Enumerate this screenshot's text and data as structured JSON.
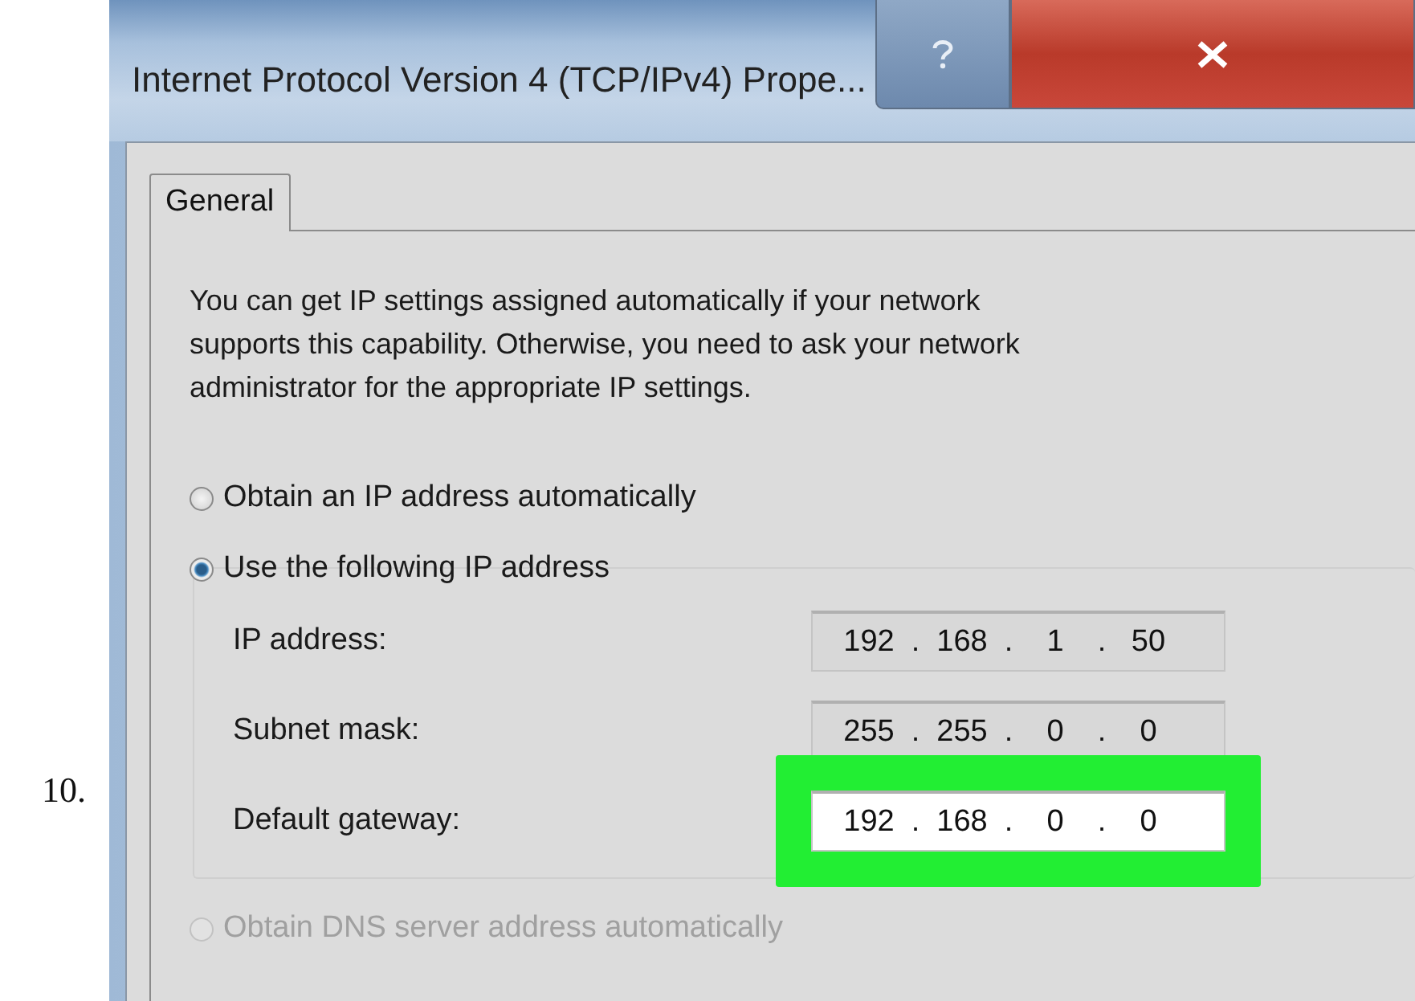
{
  "step_number": "10.",
  "window": {
    "title": "Internet Protocol Version 4 (TCP/IPv4) Prope..."
  },
  "tabs": [
    {
      "label": "General",
      "selected": true
    }
  ],
  "intro": "You can get IP settings assigned automatically if your network supports this capability. Otherwise, you need to ask your network administrator for the appropriate IP settings.",
  "ip_options": [
    {
      "label": "Obtain an IP address automatically",
      "selected": false,
      "disabled": false
    },
    {
      "label": "Use the following IP address",
      "selected": true,
      "disabled": false
    }
  ],
  "ip_fields": [
    {
      "label": "IP address:",
      "octets": [
        "192",
        "168",
        "1",
        "50"
      ],
      "separator": ".",
      "highlighted": false
    },
    {
      "label": "Subnet mask:",
      "octets": [
        "255",
        "255",
        "0",
        "0"
      ],
      "separator": ".",
      "highlighted": false
    },
    {
      "label": "Default gateway:",
      "octets": [
        "192",
        "168",
        "0",
        "0"
      ],
      "separator": ".",
      "highlighted": true
    }
  ],
  "dns_options": [
    {
      "label": "Obtain DNS server address automatically",
      "selected": false,
      "disabled": true
    }
  ]
}
